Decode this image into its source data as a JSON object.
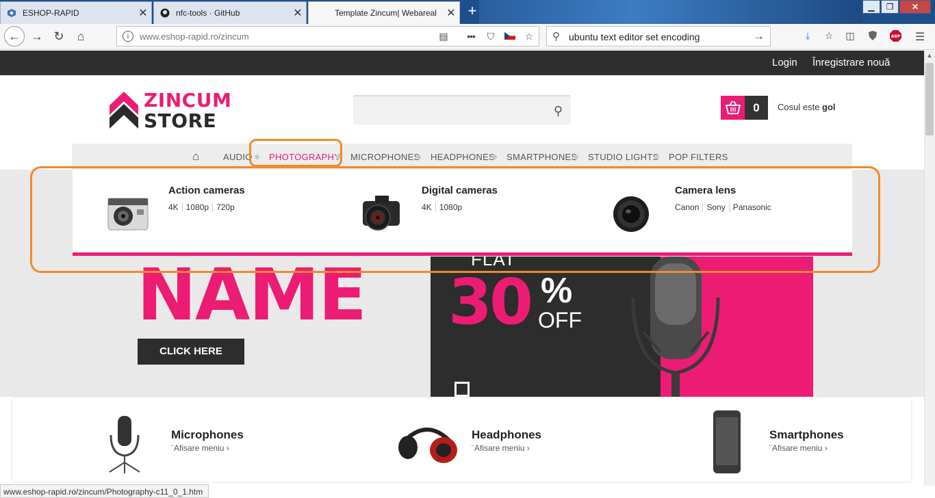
{
  "browser": {
    "tabs": [
      {
        "label": "ESHOP-RAPID"
      },
      {
        "label": "nfc-tools · GitHub"
      },
      {
        "label": "Template Zincum| Webareal"
      }
    ],
    "url_domain": "www.eshop-rapid.ro",
    "url_path": "/zincum",
    "search_text": "ubuntu text editor set encoding",
    "status_url": "www.eshop-rapid.ro/zincum/Photography-c11_0_1.htm"
  },
  "site": {
    "top_links": {
      "login": "Login",
      "register": "Înregistrare nouă"
    },
    "logo": {
      "line1": "ZINCUM",
      "line2": "STORE"
    },
    "cart": {
      "count": "0",
      "text_prefix": "Cosul este",
      "text_state": "gol"
    },
    "menu": [
      "AUDIO",
      "PHOTOGRAPHY",
      "MICROPHONES",
      "HEADPHONES",
      "SMARTPHONES",
      "STUDIO LIGHTS",
      "POP FILTERS"
    ],
    "active_menu": "PHOTOGRAPHY",
    "dropdown": [
      {
        "title": "Action cameras",
        "subs": [
          "4K",
          "1080p",
          "720p"
        ]
      },
      {
        "title": "Digital cameras",
        "subs": [
          "4K",
          "1080p"
        ]
      },
      {
        "title": "Camera lens",
        "subs": [
          "Canon",
          "Sony",
          "Panasonic"
        ]
      }
    ],
    "hero": {
      "name": "NAME",
      "button": "CLICK HERE",
      "flat": "FLAT",
      "amount": "30",
      "percent": "%",
      "off": "OFF"
    },
    "categories": [
      {
        "title": "Microphones",
        "sub": "¨Afisare meniu"
      },
      {
        "title": "Headphones",
        "sub": "¨Afisare meniu"
      },
      {
        "title": "Smartphones",
        "sub": "¨Afisare meniu"
      }
    ],
    "accent_color": "#ec1c74"
  }
}
